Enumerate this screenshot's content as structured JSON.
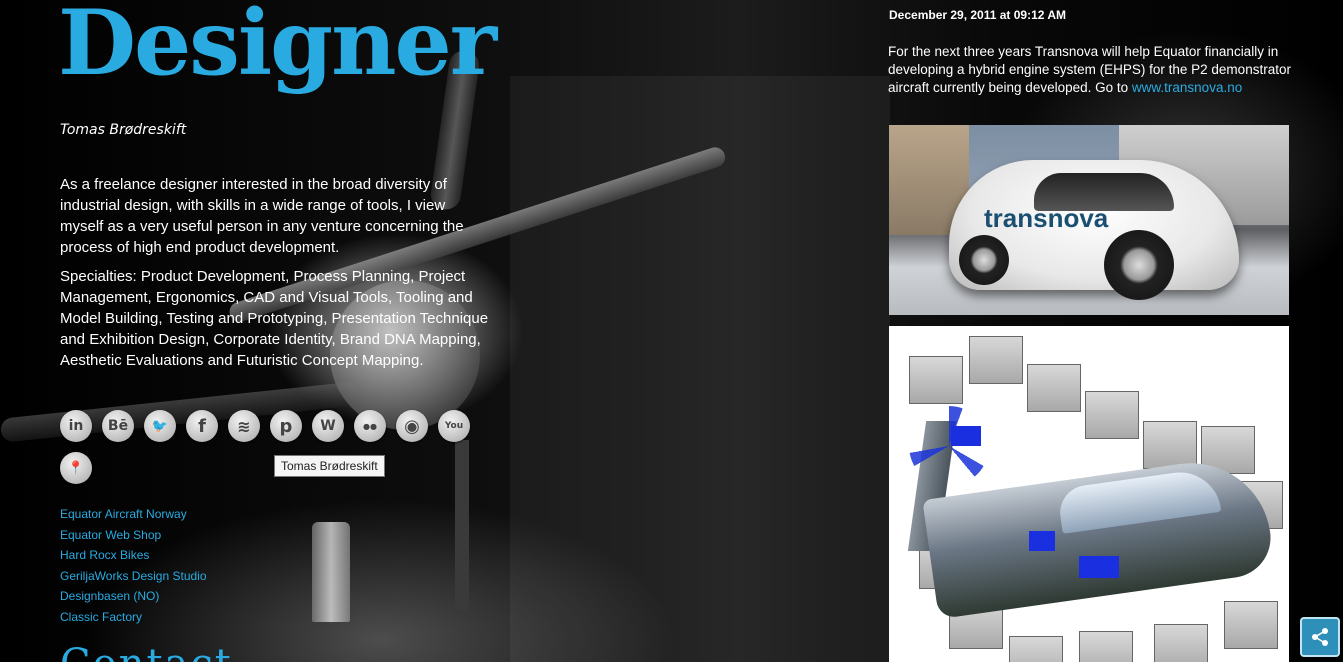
{
  "headline": "Designer",
  "author": "Tomas Brødreskift",
  "bio": "As a freelance designer interested in the broad diversity of industrial design, with skills in a wide range of tools, I view myself as a very useful person in any venture concerning the process of high end product development.",
  "specialties": "Specialties: Product Development, Process Planning, Project Management, Ergonomics, CAD and Visual Tools, Tooling and Model Building, Testing and Prototyping, Presentation Technique and Exhibition Design, Corporate Identity, Brand DNA Mapping, Aesthetic Evaluations and Futuristic Concept Mapping.",
  "social": [
    {
      "icon": "linkedin-icon",
      "glyph": "in"
    },
    {
      "icon": "behance-icon",
      "glyph": "Bē"
    },
    {
      "icon": "twitter-icon",
      "glyph": "🐦"
    },
    {
      "icon": "facebook-icon",
      "glyph": "f"
    },
    {
      "icon": "vimeo-icon",
      "glyph": "≋"
    },
    {
      "icon": "pinterest-icon",
      "glyph": "p"
    },
    {
      "icon": "wordpress-icon",
      "glyph": "W"
    },
    {
      "icon": "flickr-icon",
      "glyph": "●●"
    },
    {
      "icon": "instagram-icon",
      "glyph": "◉"
    },
    {
      "icon": "youtube-icon",
      "glyph": "You"
    },
    {
      "icon": "map-pin-icon",
      "glyph": "📍"
    }
  ],
  "tooltip": "Tomas Brødreskift",
  "links": [
    "Equator Aircraft Norway",
    "Equator Web Shop",
    "Hard Rocx Bikes",
    "GeriljaWorks Design Studio",
    "Designbasen (NO)",
    "Classic Factory"
  ],
  "contact_heading_partial": "Contact",
  "post": {
    "date": "December 29, 2011 at 09:12 AM",
    "text": "For the next three years Transnova will help Equator financially in developing a hybrid engine system (EHPS) for the P2 demonstrator aircraft currently being developed. Go to",
    "link": "www.transnova.no",
    "photo_brand": "transnova"
  },
  "colors": {
    "accent": "#29abe2",
    "background": "#000000",
    "text": "#ffffff"
  },
  "share_icon": "share-icon"
}
